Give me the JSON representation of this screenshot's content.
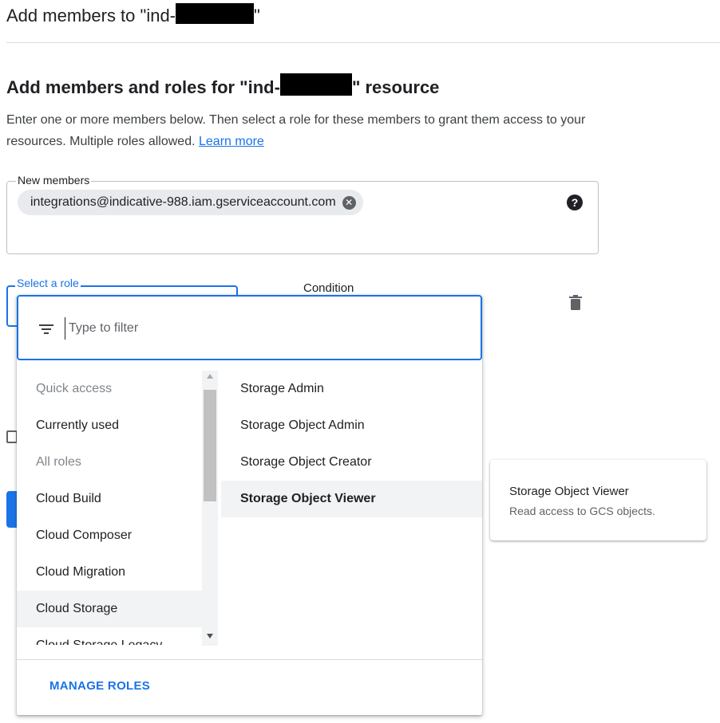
{
  "header": {
    "title_prefix": "Add members to \"ind-",
    "title_suffix": "\""
  },
  "section": {
    "title_prefix": "Add members and roles for \"ind-",
    "title_suffix": "\" resource",
    "description": "Enter one or more members below. Then select a role for these members to grant them access to your resources. Multiple roles allowed. ",
    "learn_more": "Learn more"
  },
  "members": {
    "label": "New members",
    "chip": "integrations@indicative-988.iam.gserviceaccount.com",
    "help_icon": "question-circle-icon"
  },
  "role": {
    "label": "Select a role",
    "condition_label": "Condition"
  },
  "dropdown": {
    "filter_placeholder": "Type to filter",
    "categories": [
      {
        "label": "Quick access",
        "muted": true
      },
      {
        "label": "Currently used",
        "muted": false
      },
      {
        "label": "All roles",
        "muted": true
      },
      {
        "label": "Cloud Build",
        "muted": false
      },
      {
        "label": "Cloud Composer",
        "muted": false
      },
      {
        "label": "Cloud Migration",
        "muted": false
      },
      {
        "label": "Cloud Storage",
        "muted": false,
        "selected": true
      },
      {
        "label": "Cloud Storage Legacy",
        "muted": false
      }
    ],
    "roles": [
      {
        "label": "Storage Admin"
      },
      {
        "label": "Storage Object Admin"
      },
      {
        "label": "Storage Object Creator"
      },
      {
        "label": "Storage Object Viewer",
        "selected": true
      }
    ],
    "manage_roles": "MANAGE ROLES"
  },
  "info_card": {
    "title": "Storage Object Viewer",
    "description": "Read access to GCS objects."
  },
  "colors": {
    "accent": "#1a73e8",
    "selected_bg": "#f1f3f4"
  }
}
